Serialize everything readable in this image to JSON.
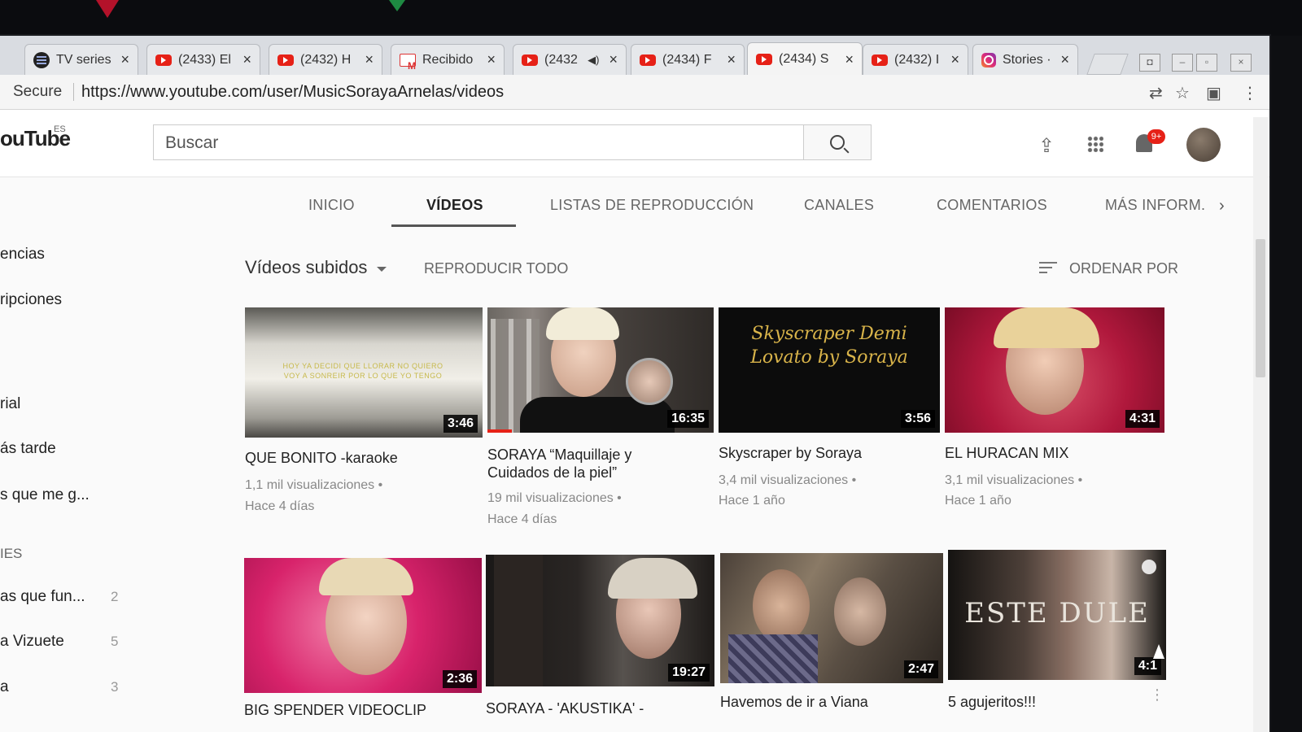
{
  "tabs": [
    {
      "label": "TV series",
      "icon": "spotify-icon"
    },
    {
      "label": "(2433) El",
      "icon": "youtube-icon"
    },
    {
      "label": "(2432) H",
      "icon": "youtube-icon"
    },
    {
      "label": "Recibido",
      "icon": "gmail-icon"
    },
    {
      "label": "(2432",
      "icon": "youtube-icon"
    },
    {
      "label": "(2434) F",
      "icon": "youtube-icon"
    },
    {
      "label": "(2434) S",
      "icon": "youtube-icon"
    },
    {
      "label": "(2432) I",
      "icon": "youtube-icon"
    },
    {
      "label": "Stories ·",
      "icon": "instagram-icon"
    }
  ],
  "address": {
    "secure": "Secure",
    "url": "https://www.youtube.com/user/MusicSorayaArnelas/videos"
  },
  "header": {
    "logo": "ouTube",
    "logo_region": "ES",
    "search_placeholder": "Buscar",
    "notification_count": "9+"
  },
  "sidebar": {
    "items": [
      {
        "label": "encias",
        "count": ""
      },
      {
        "label": "ripciones",
        "count": ""
      },
      {
        "label": "rial",
        "count": ""
      },
      {
        "label": "ás tarde",
        "count": ""
      },
      {
        "label": "s que me g...",
        "count": ""
      },
      {
        "label": "IES",
        "count": ""
      },
      {
        "label": "as que fun...",
        "count": "2"
      },
      {
        "label": "a Vizuete",
        "count": "5"
      },
      {
        "label": "a",
        "count": "3"
      }
    ]
  },
  "channel_tabs": [
    "INICIO",
    "VÍDEOS",
    "LISTAS DE REPRODUCCIÓN",
    "CANALES",
    "COMENTARIOS",
    "MÁS INFORM."
  ],
  "controls": {
    "uploads": "Vídeos subidos",
    "play_all": "REPRODUCIR TODO",
    "sort_by": "ORDENAR POR"
  },
  "videos": [
    {
      "title": "QUE BONITO -karaoke",
      "duration": "3:46",
      "views": "1,1 mil visualizaciones •",
      "age": "Hace 4 días",
      "thumb_text": "HOY YA DECIDI QUE LLORAR NO QUIERO VOY A SONREIR POR LO QUE YO TENGO"
    },
    {
      "title": "SORAYA “Maquillaje y Cuidados de la piel”",
      "duration": "16:35",
      "views": "19 mil visualizaciones •",
      "age": "Hace 4 días"
    },
    {
      "title": "Skyscraper by Soraya",
      "duration": "3:56",
      "views": "3,4 mil visualizaciones •",
      "age": "Hace 1 año",
      "thumb_text": "Skyscraper Demi Lovato by Soraya"
    },
    {
      "title": "EL HURACAN MIX",
      "duration": "4:31",
      "views": "3,1 mil visualizaciones •",
      "age": "Hace 1 año"
    },
    {
      "title": "BIG SPENDER VIDEOCLIP",
      "duration": "2:36"
    },
    {
      "title": "SORAYA - 'AKUSTIKA' -",
      "duration": "19:27"
    },
    {
      "title": "Havemos de ir a Viana",
      "duration": "2:47"
    },
    {
      "title": "5 agujeritos!!!",
      "duration": "4:1",
      "thumb_text": "ESTE DULE"
    }
  ],
  "colors": {
    "youtube_red": "#e62117",
    "accent_underline": "#555555"
  }
}
